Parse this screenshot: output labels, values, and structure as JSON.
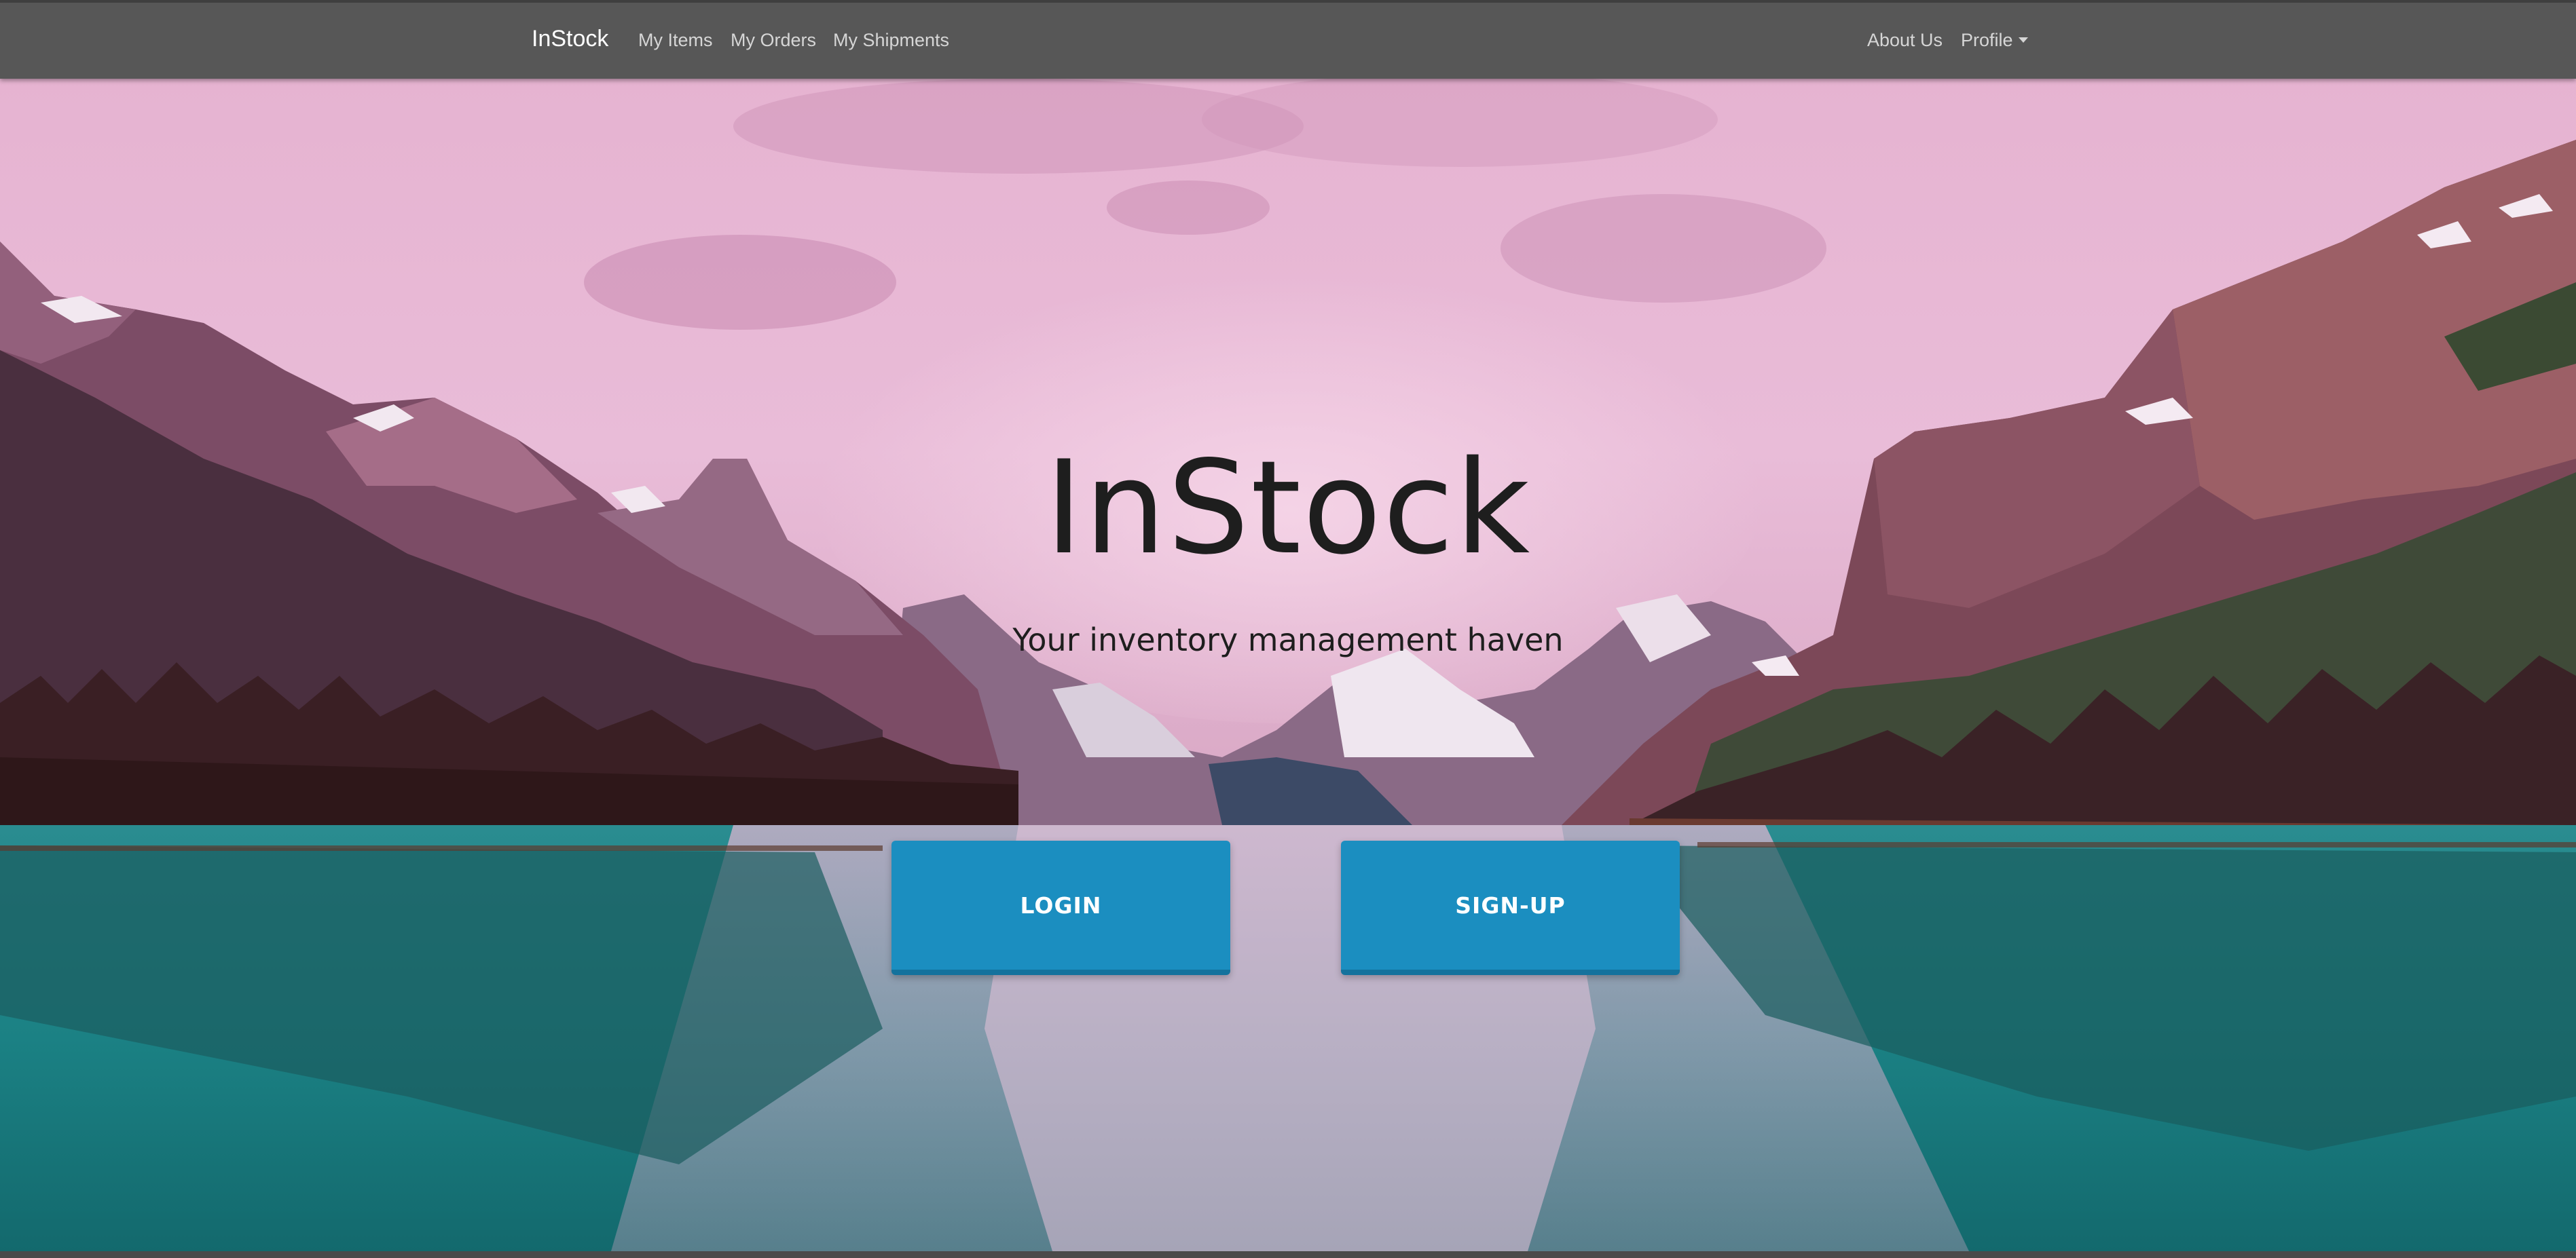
{
  "navbar": {
    "brand": "InStock",
    "links": [
      "My Items",
      "My Orders",
      "My Shipments"
    ],
    "about": "About Us",
    "profile": "Profile"
  },
  "hero": {
    "title": "InStock",
    "subtitle": "Your inventory management haven",
    "login_label": "LOGIN",
    "signup_label": "SIGN-UP",
    "background": "mountain-lake-photo"
  },
  "colors": {
    "navbar": "#575757",
    "button": "#1b8ec0",
    "button_shadow": "#14729d"
  }
}
